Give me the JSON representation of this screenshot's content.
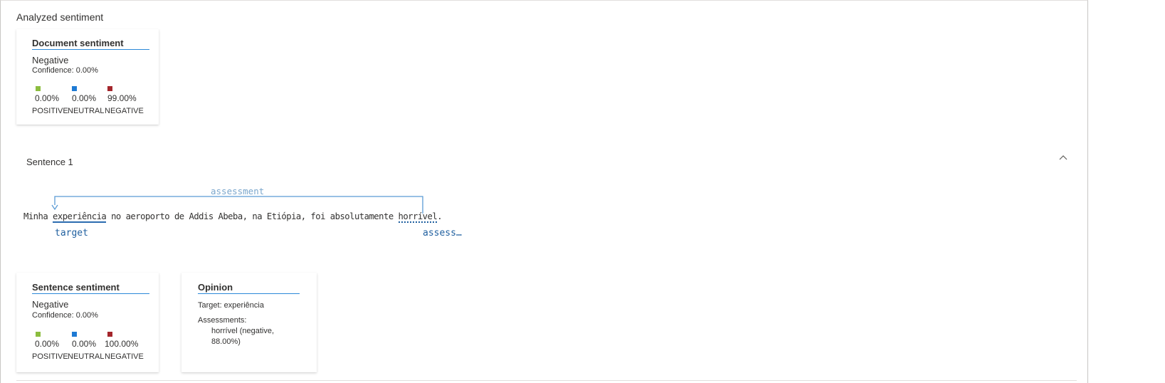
{
  "panel": {
    "title": "Analyzed sentiment"
  },
  "document_card": {
    "title": "Document sentiment",
    "sentiment": "Negative",
    "confidence": "Confidence: 0.00%",
    "metrics": [
      {
        "value": "0.00%",
        "label": "POSITIVE",
        "color": "#8cbd3f"
      },
      {
        "value": "0.00%",
        "label": "NEUTRAL",
        "color": "#1e7ad4"
      },
      {
        "value": "99.00%",
        "label": "NEGATIVE",
        "color": "#a4262c"
      }
    ]
  },
  "sentence": {
    "header": "Sentence 1",
    "expand_icon": "chevron-up-icon",
    "text_before": "Minha ",
    "target_word": "experiência",
    "text_middle": " no aeroporto de Addis Abeba, na Etiópia, foi absolutamente ",
    "assessment_word": "horrível",
    "text_after": ".",
    "relation_label": "assessment",
    "target_tag": "target",
    "assessment_tag": "assess…"
  },
  "sentence_card": {
    "title": "Sentence sentiment",
    "sentiment": "Negative",
    "confidence": "Confidence: 0.00%",
    "metrics": [
      {
        "value": "0.00%",
        "label": "POSITIVE",
        "color": "#8cbd3f"
      },
      {
        "value": "0.00%",
        "label": "NEUTRAL",
        "color": "#1e7ad4"
      },
      {
        "value": "100.00%",
        "label": "NEGATIVE",
        "color": "#a4262c"
      }
    ]
  },
  "opinion_card": {
    "title": "Opinion",
    "target_line": "Target: experiência",
    "assessments_label": "Assessments:",
    "assessment_line1": "horrível (negative,",
    "assessment_line2": "88.00%)"
  }
}
